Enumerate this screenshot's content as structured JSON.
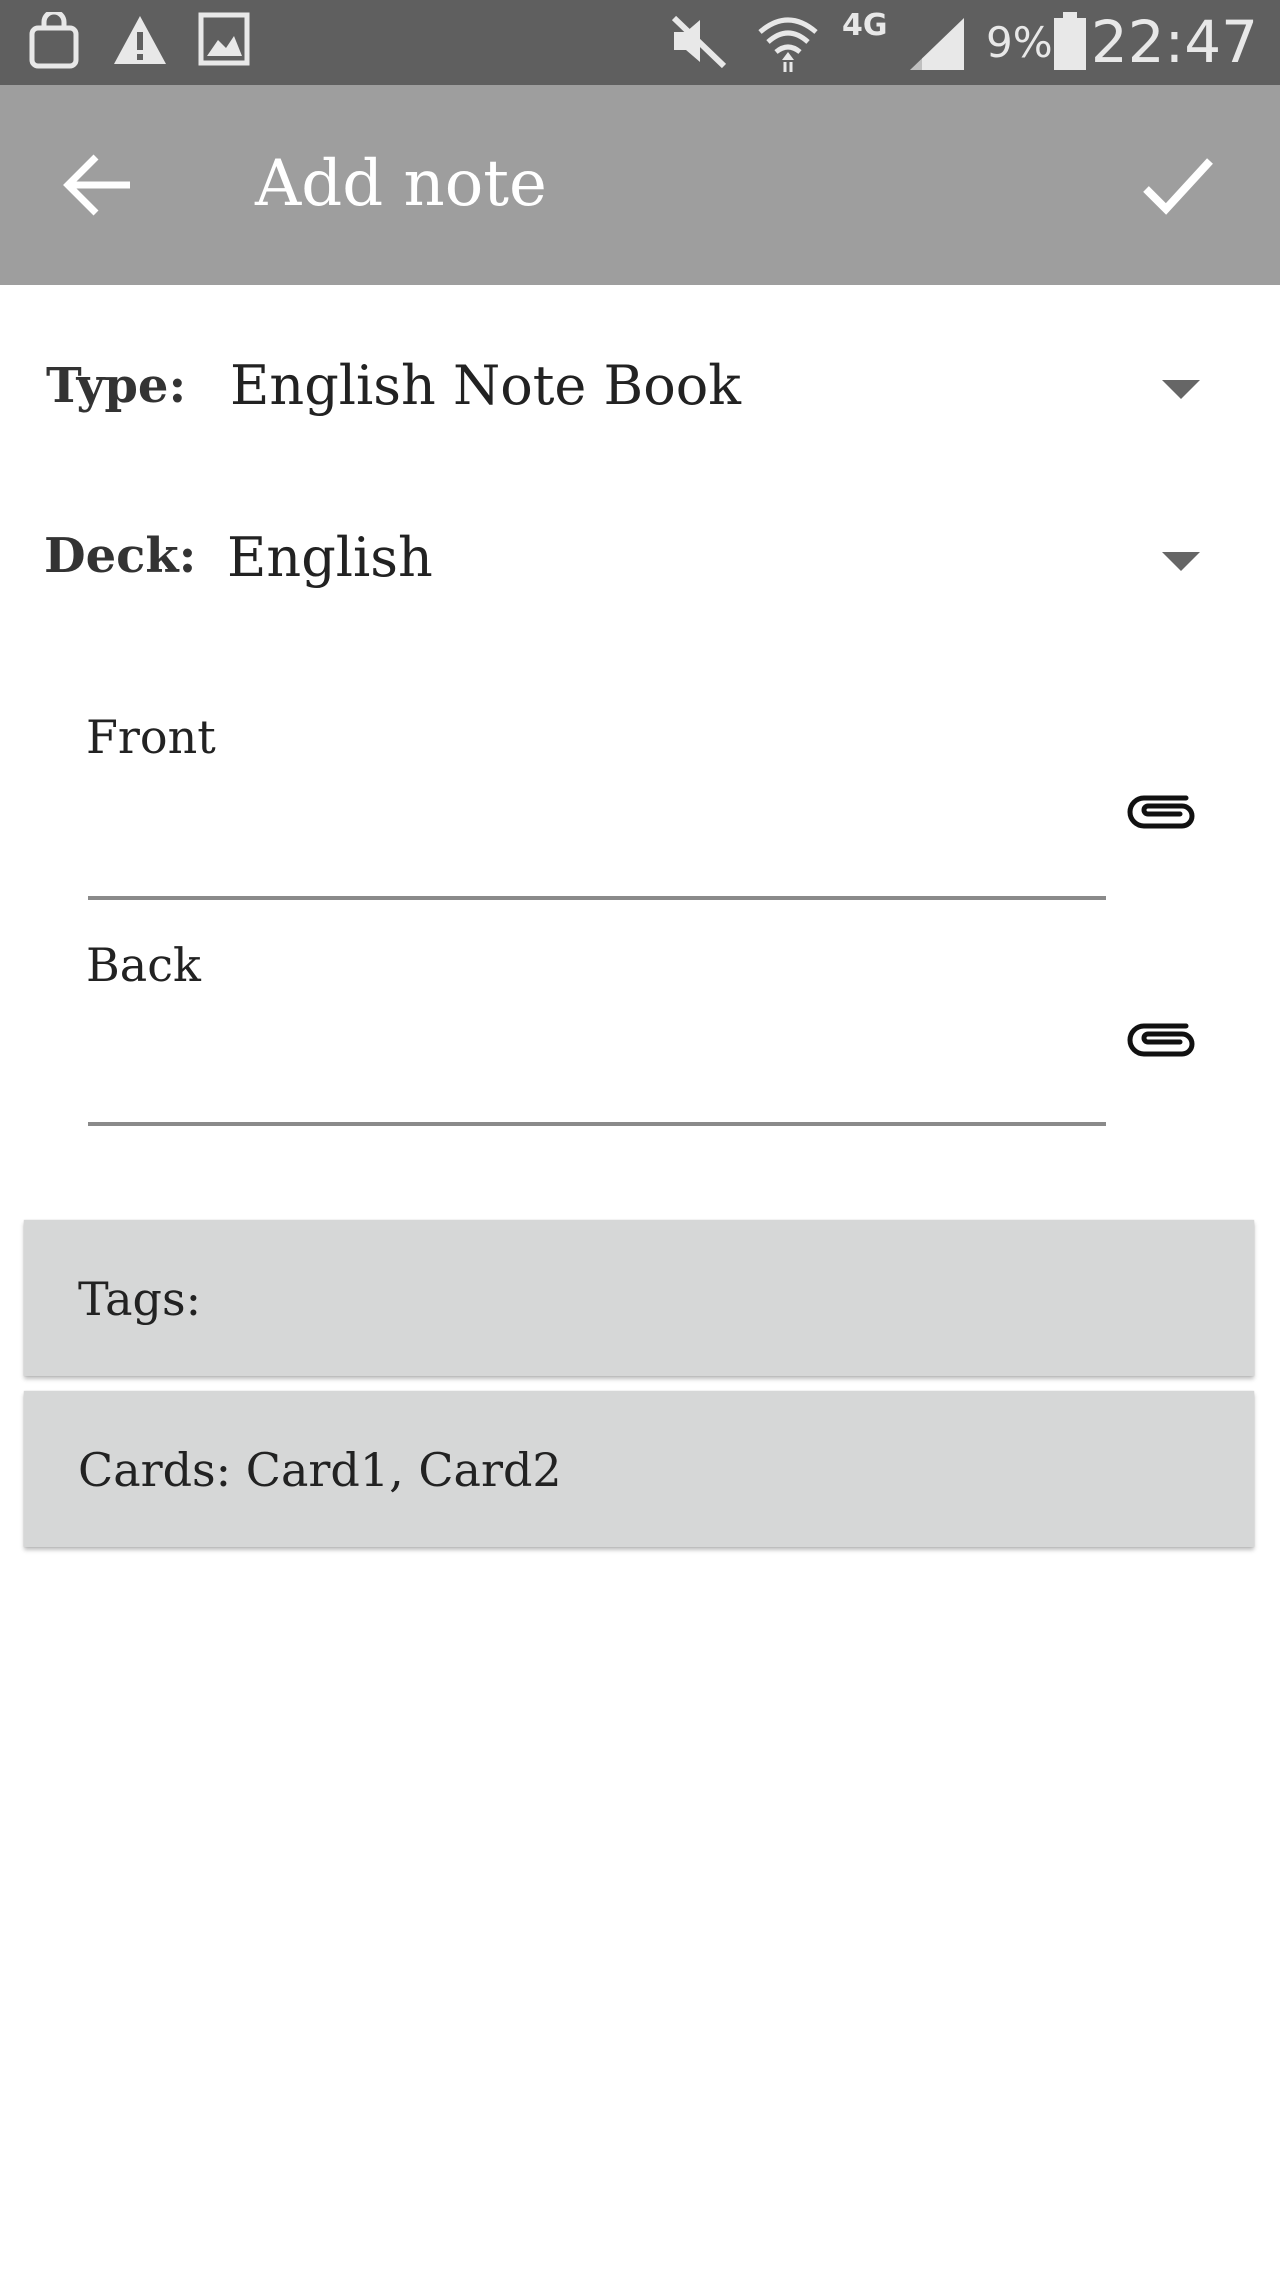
{
  "status_bar": {
    "icons": [
      "shopping-bag-icon",
      "warning-icon",
      "image-icon",
      "mute-icon",
      "wifi-icon",
      "signal-icon",
      "battery-icon"
    ],
    "network": "4G",
    "battery": "9%",
    "time": "22:47"
  },
  "app_bar": {
    "title": "Add note",
    "back_icon": "arrow-left-icon",
    "confirm_icon": "check-icon"
  },
  "form": {
    "type_label": "Type:",
    "type_value": "English Note Book",
    "deck_label": "Deck:",
    "deck_value": "English",
    "fields": [
      {
        "label": "Front",
        "value": ""
      },
      {
        "label": "Back",
        "value": ""
      }
    ]
  },
  "panels": {
    "tags": "Tags:",
    "cards": "Cards: Card1, Card2"
  },
  "colors": {
    "status_bar": "#5f5f5f",
    "app_bar": "#9e9e9e",
    "panel": "#d6d7d7",
    "divider": "#8a8a8a"
  }
}
